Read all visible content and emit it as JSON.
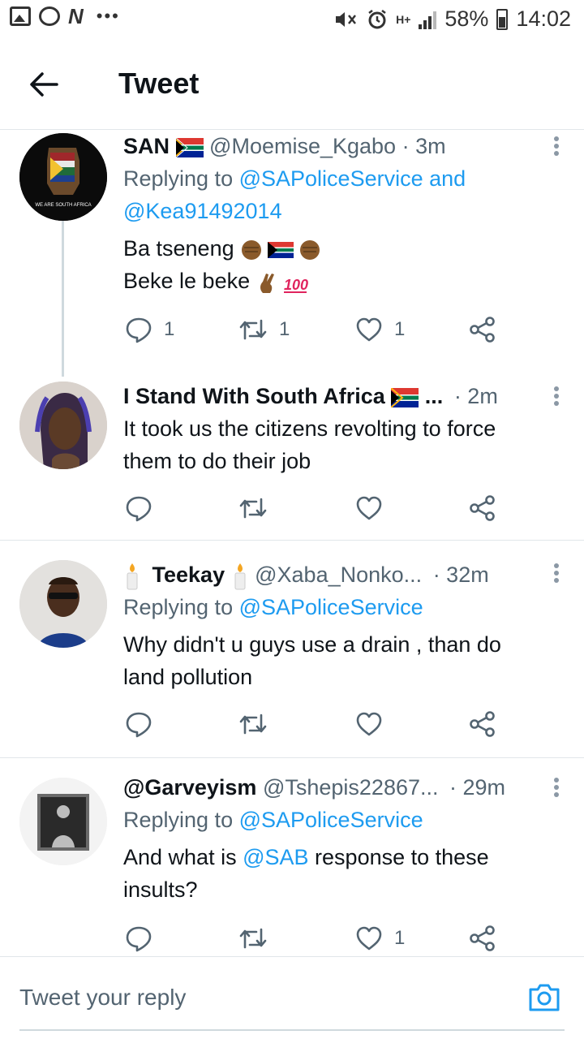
{
  "status_bar": {
    "battery": "58%",
    "time": "14:02",
    "network": "H+",
    "icons": [
      "gallery-icon",
      "whatsapp-icon",
      "news-icon",
      "more-dots-icon",
      "mute-icon",
      "alarm-icon",
      "signal-icon",
      "battery-icon"
    ]
  },
  "header": {
    "title": "Tweet",
    "back_icon": "arrow-left-icon"
  },
  "tweets": [
    {
      "name": "SAN",
      "handle": "@Moemise_Kgabo",
      "time": "· 3m",
      "replying_prefix": "Replying to",
      "replying_to_1": "@SAPoliceService",
      "replying_and": "and",
      "replying_to_2": "@Kea91492014",
      "text_line_1": "Ba tseneng",
      "text_line_2": "Beke le beke",
      "avatar_caption": "WE ARE SOUTH AFRICA",
      "replies": "1",
      "retweets": "1",
      "likes": "1"
    },
    {
      "name": "I Stand With South Africa",
      "name_ellipsis": "...",
      "time": "· 2m",
      "text": "It took us the citizens revolting to force them to do their job"
    },
    {
      "name": "Teekay",
      "handle": "@Xaba_Nonko...",
      "time": "· 32m",
      "replying_prefix": "Replying to",
      "replying_to_1": "@SAPoliceService",
      "text": "Why didn't u guys use a drain , than do land pollution"
    },
    {
      "name": "@Garveyism",
      "handle": "@Tshepis22867...",
      "time": "· 29m",
      "replying_prefix": "Replying to",
      "replying_to_1": "@SAPoliceService",
      "text_before": "And what is",
      "text_mention": "@SAB",
      "text_after": "response to these insults?",
      "likes": "1"
    }
  ],
  "reply_bar": {
    "placeholder": "Tweet your reply",
    "camera_icon": "camera-icon"
  }
}
